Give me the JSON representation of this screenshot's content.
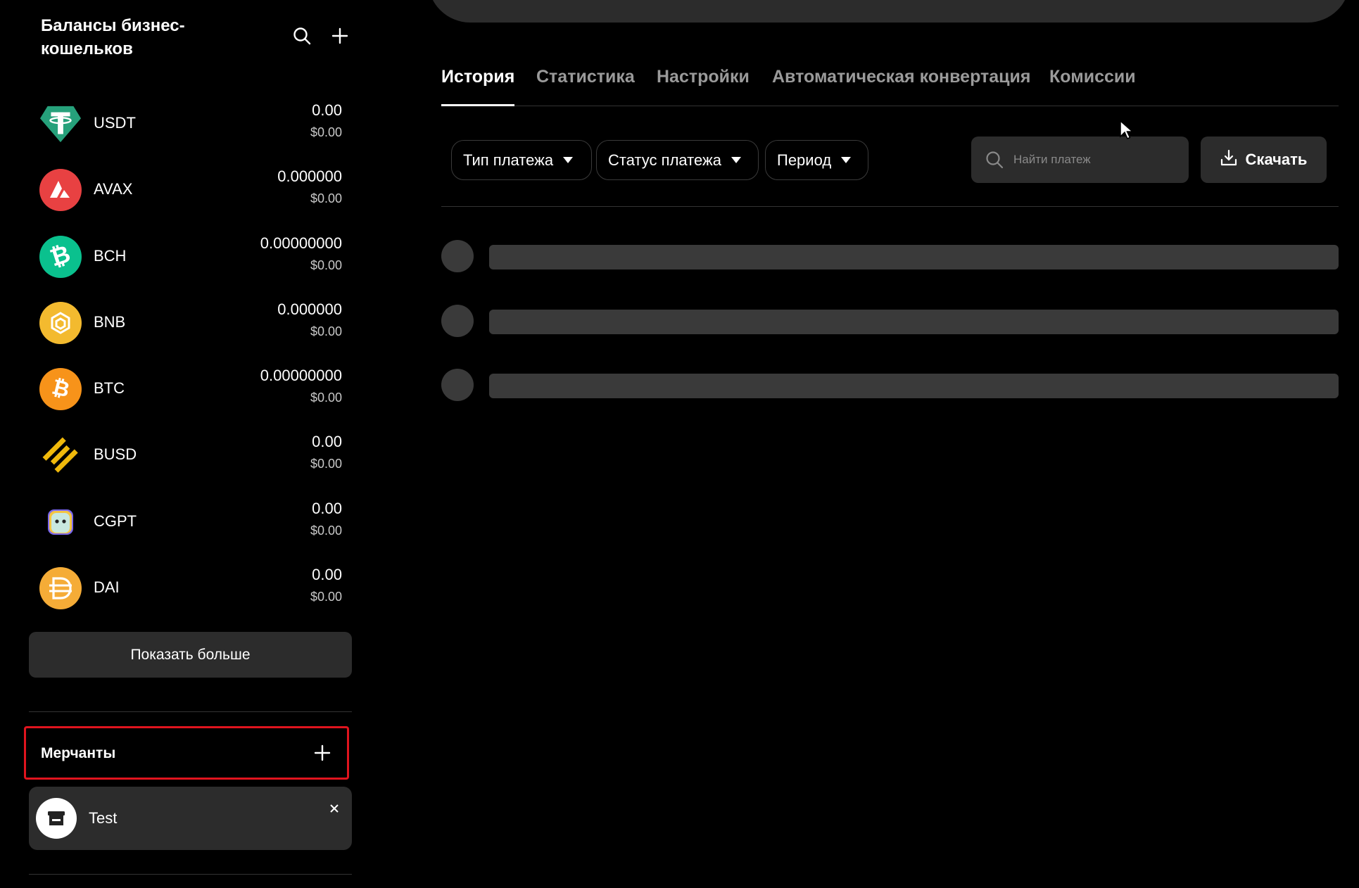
{
  "sidebar": {
    "title": "Балансы бизнес-кошельков",
    "coins": [
      {
        "name": "USDT",
        "amount": "0.00",
        "usd": "$0.00",
        "color": "#26a17b",
        "icon": "tether-icon"
      },
      {
        "name": "AVAX",
        "amount": "0.000000",
        "usd": "$0.00",
        "color": "#e84142",
        "icon": "avalanche-icon"
      },
      {
        "name": "BCH",
        "amount": "0.00000000",
        "usd": "$0.00",
        "color": "#0ac18e",
        "icon": "bitcoin-cash-icon"
      },
      {
        "name": "BNB",
        "amount": "0.000000",
        "usd": "$0.00",
        "color": "#f3ba2f",
        "icon": "bnb-icon"
      },
      {
        "name": "BTC",
        "amount": "0.00000000",
        "usd": "$0.00",
        "color": "#f7931a",
        "icon": "bitcoin-icon"
      },
      {
        "name": "BUSD",
        "amount": "0.00",
        "usd": "$0.00",
        "color": "#f0b90b",
        "icon": "busd-icon"
      },
      {
        "name": "CGPT",
        "amount": "0.00",
        "usd": "$0.00",
        "color": "#9bd5c7",
        "icon": "cgpt-icon"
      },
      {
        "name": "DAI",
        "amount": "0.00",
        "usd": "$0.00",
        "color": "#f5ac37",
        "icon": "dai-icon"
      }
    ],
    "show_more_label": "Показать больше",
    "merchants": {
      "title": "Мерчанты",
      "items": [
        {
          "name": "Test",
          "icon": "store-icon"
        }
      ]
    }
  },
  "main": {
    "tabs": [
      {
        "label": "История",
        "active": true
      },
      {
        "label": "Статистика",
        "active": false
      },
      {
        "label": "Настройки",
        "active": false
      },
      {
        "label": "Автоматическая конвертация",
        "active": false
      },
      {
        "label": "Комиссии",
        "active": false
      }
    ],
    "filters": {
      "payment_type": "Тип платежа",
      "payment_status": "Статус платежа",
      "period": "Период"
    },
    "search": {
      "placeholder": "Найти платеж"
    },
    "download_label": "Скачать",
    "skeleton_rows": 3
  },
  "colors": {
    "background": "#000000",
    "surface": "#2c2c2c",
    "skeleton": "#3a3a3a",
    "highlight_border": "#e0141e",
    "tab_inactive": "#9a9a9a"
  }
}
